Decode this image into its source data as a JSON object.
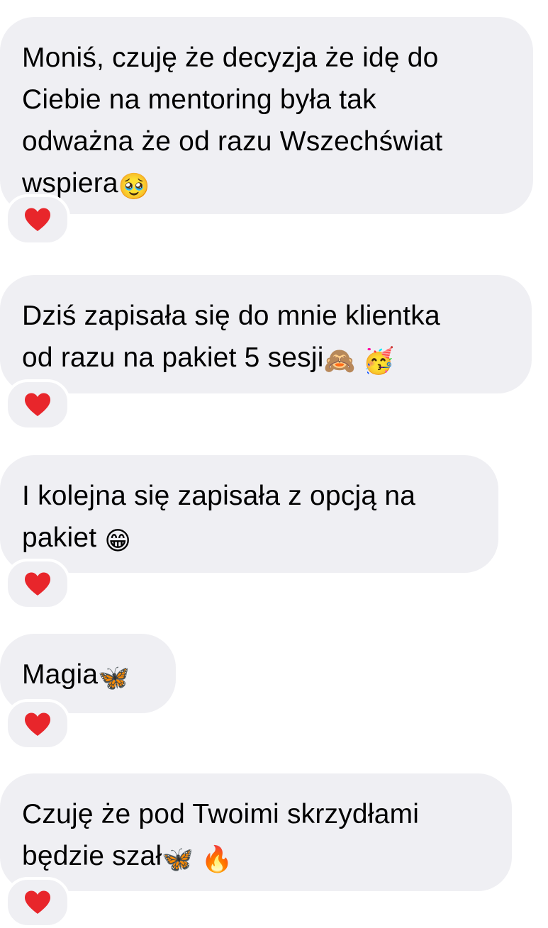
{
  "messages": [
    {
      "lines": [
        "Moniś, czuję że decyzja że idę do",
        "Ciebie na mentoring była tak",
        "odważna że od razu Wszechświat",
        "wspiera"
      ],
      "trailing_emoji": "🥹",
      "trailing_emoji_icon": "pleading-face-icon",
      "reaction": "❤️"
    },
    {
      "lines": [
        "Dziś zapisała się do mnie klientka",
        "od razu na pakiet 5 sesji"
      ],
      "trailing_emoji": "🙈 🥳",
      "trailing_emoji_icon": "see-no-evil-monkey-and-partying-face-icon",
      "reaction": "❤️"
    },
    {
      "lines": [
        "I kolejna się zapisała z opcją na",
        "pakiet "
      ],
      "trailing_emoji": "😁",
      "trailing_emoji_icon": "grinning-face-icon",
      "reaction": "❤️"
    },
    {
      "lines": [
        "Magia"
      ],
      "trailing_emoji": "🦋",
      "trailing_emoji_icon": "butterfly-icon",
      "reaction": "❤️"
    },
    {
      "lines": [
        "Czuję że pod Twoimi skrzydłami",
        "będzie szał"
      ],
      "trailing_emoji": "🦋 🔥",
      "trailing_emoji_icon": "butterfly-and-fire-icon",
      "reaction": "❤️"
    }
  ],
  "colors": {
    "bubble_background": "#efeff3",
    "text": "#000000",
    "heart": "#e8262b"
  }
}
